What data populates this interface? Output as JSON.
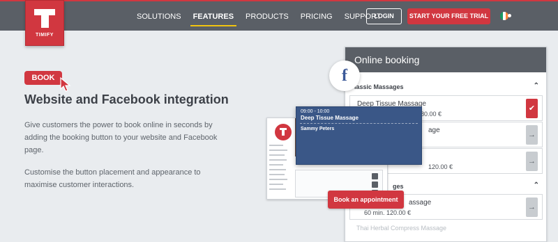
{
  "header": {
    "brand": "TIMIFY",
    "nav": [
      "SOLUTIONS",
      "FEATURES",
      "PRODUCTS",
      "PRICING",
      "SUPPORT"
    ],
    "active_nav": "FEATURES",
    "login_label": "LOGIN",
    "trial_label": "START YOUR FREE TRIAL",
    "language_flag": "irish-flag-icon"
  },
  "hero": {
    "badge": "BOOK",
    "title": "Website and Facebook integration",
    "paragraph1": "Give customers the power to book online in seconds by adding the booking button to your website and Facebook page.",
    "paragraph2": "Customise the button placement and appearance to maximise customer interactions."
  },
  "booking_widget": {
    "title": "Online booking",
    "category1": "lassic Massages",
    "category2": "ges",
    "services": [
      {
        "name": "Deep Tissue Massage",
        "meta": "80.00 €",
        "action": "check-icon"
      },
      {
        "name": "age",
        "meta": "",
        "action": "arrow-right-icon"
      },
      {
        "name": "",
        "meta": "120.00 €",
        "action": "arrow-right-icon"
      },
      {
        "name": "assage",
        "meta": "60 min.   120.00 €",
        "action": "arrow-right-icon"
      }
    ],
    "faded_item": "Thai Herbal Compress Massage"
  },
  "popup": {
    "time": "09:00 - 10:00",
    "title": "Deep Tissue Massage",
    "person": "Sammy Peters"
  },
  "appointment_button": "Book an appointment",
  "colors": {
    "brand_red": "#d13740",
    "header_gray": "#5a5f66",
    "popup_blue": "#3a5787",
    "accent_yellow": "#f1c40f",
    "facebook_blue": "#3b5998"
  }
}
